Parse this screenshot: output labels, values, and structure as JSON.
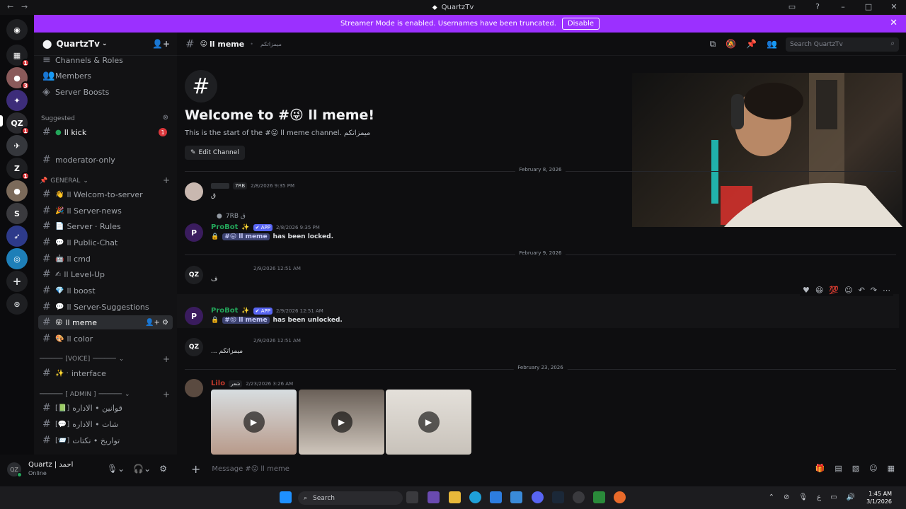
{
  "titlebar": {
    "title": "QuartzTv"
  },
  "banner": {
    "text": "Streamer Mode is enabled. Usernames have been truncated.",
    "button": "Disable"
  },
  "guild": {
    "name": "QuartzTv"
  },
  "channels": {
    "top_items": [
      "Channels & Roles",
      "Members",
      "Server Boosts"
    ],
    "suggested_label": "Suggested",
    "suggested_item": "ll kick",
    "moderator": "moderator-only",
    "general_cat": "GENERAL",
    "general": [
      {
        "emoji": "👋",
        "name": "ll Welcom-to-server"
      },
      {
        "emoji": "🎉",
        "name": "ll Server-news"
      },
      {
        "emoji": "📄",
        "name": "Server · Rules"
      },
      {
        "emoji": "💬",
        "name": "ll Public-Chat"
      },
      {
        "emoji": "🤖",
        "name": "ll cmd"
      },
      {
        "emoji": "✍",
        "name": "ll Level-Up"
      },
      {
        "emoji": "💎",
        "name": "ll boost"
      },
      {
        "emoji": "💬",
        "name": "ll Server-Suggestions"
      },
      {
        "emoji": "😜",
        "name": "ll meme"
      },
      {
        "emoji": "🎨",
        "name": "ll color"
      }
    ],
    "voice_cat": "[VOICE]",
    "voice_item": "interface",
    "admin_cat": "[ ADMIN ]",
    "admin": [
      "قوانين • الاداره",
      "شات • الاداره",
      "تواريخ • نكتات"
    ]
  },
  "user": {
    "name": "Quartz | احمد",
    "status": "Online"
  },
  "header": {
    "channel": "ll meme",
    "topic": "ميمزاتكم",
    "search": "Search QuartzTv"
  },
  "welcome": {
    "title": "Welcome to #😜 ll meme!",
    "sub": "This is the start of the #😜 ll meme channel. ميمزاتكم",
    "edit": "Edit Channel"
  },
  "dates": [
    "February 8, 2026",
    "February 9, 2026",
    "February 23, 2026"
  ],
  "messages": {
    "m1": {
      "tag": "7RB",
      "time": "2/8/2026 9:35 PM",
      "text": "ق"
    },
    "m2_reply": "7RB ق",
    "m2": {
      "author": "ProBot",
      "tag": "APP",
      "time": "2/8/2026 9:35 PM",
      "mention": "#😜 ll meme",
      "text": "has been locked."
    },
    "m3": {
      "time": "2/9/2026 12:51 AM",
      "text": "ف"
    },
    "m4": {
      "author": "ProBot",
      "tag": "APP",
      "time": "2/9/2026 12:51 AM",
      "mention": "#😜 ll meme",
      "text": "has been unlocked."
    },
    "m5": {
      "time": "2/9/2026 12:51 AM",
      "text": "... ميمزاتكم"
    },
    "m6": {
      "author": "Lilo",
      "tag": "شعر",
      "time": "2/23/2026 3:26 AM"
    }
  },
  "composer": {
    "placeholder": "Message #😜 ll meme"
  },
  "taskbar": {
    "search": "Search",
    "time": "1:45 AM",
    "date": "3/1/2026"
  }
}
